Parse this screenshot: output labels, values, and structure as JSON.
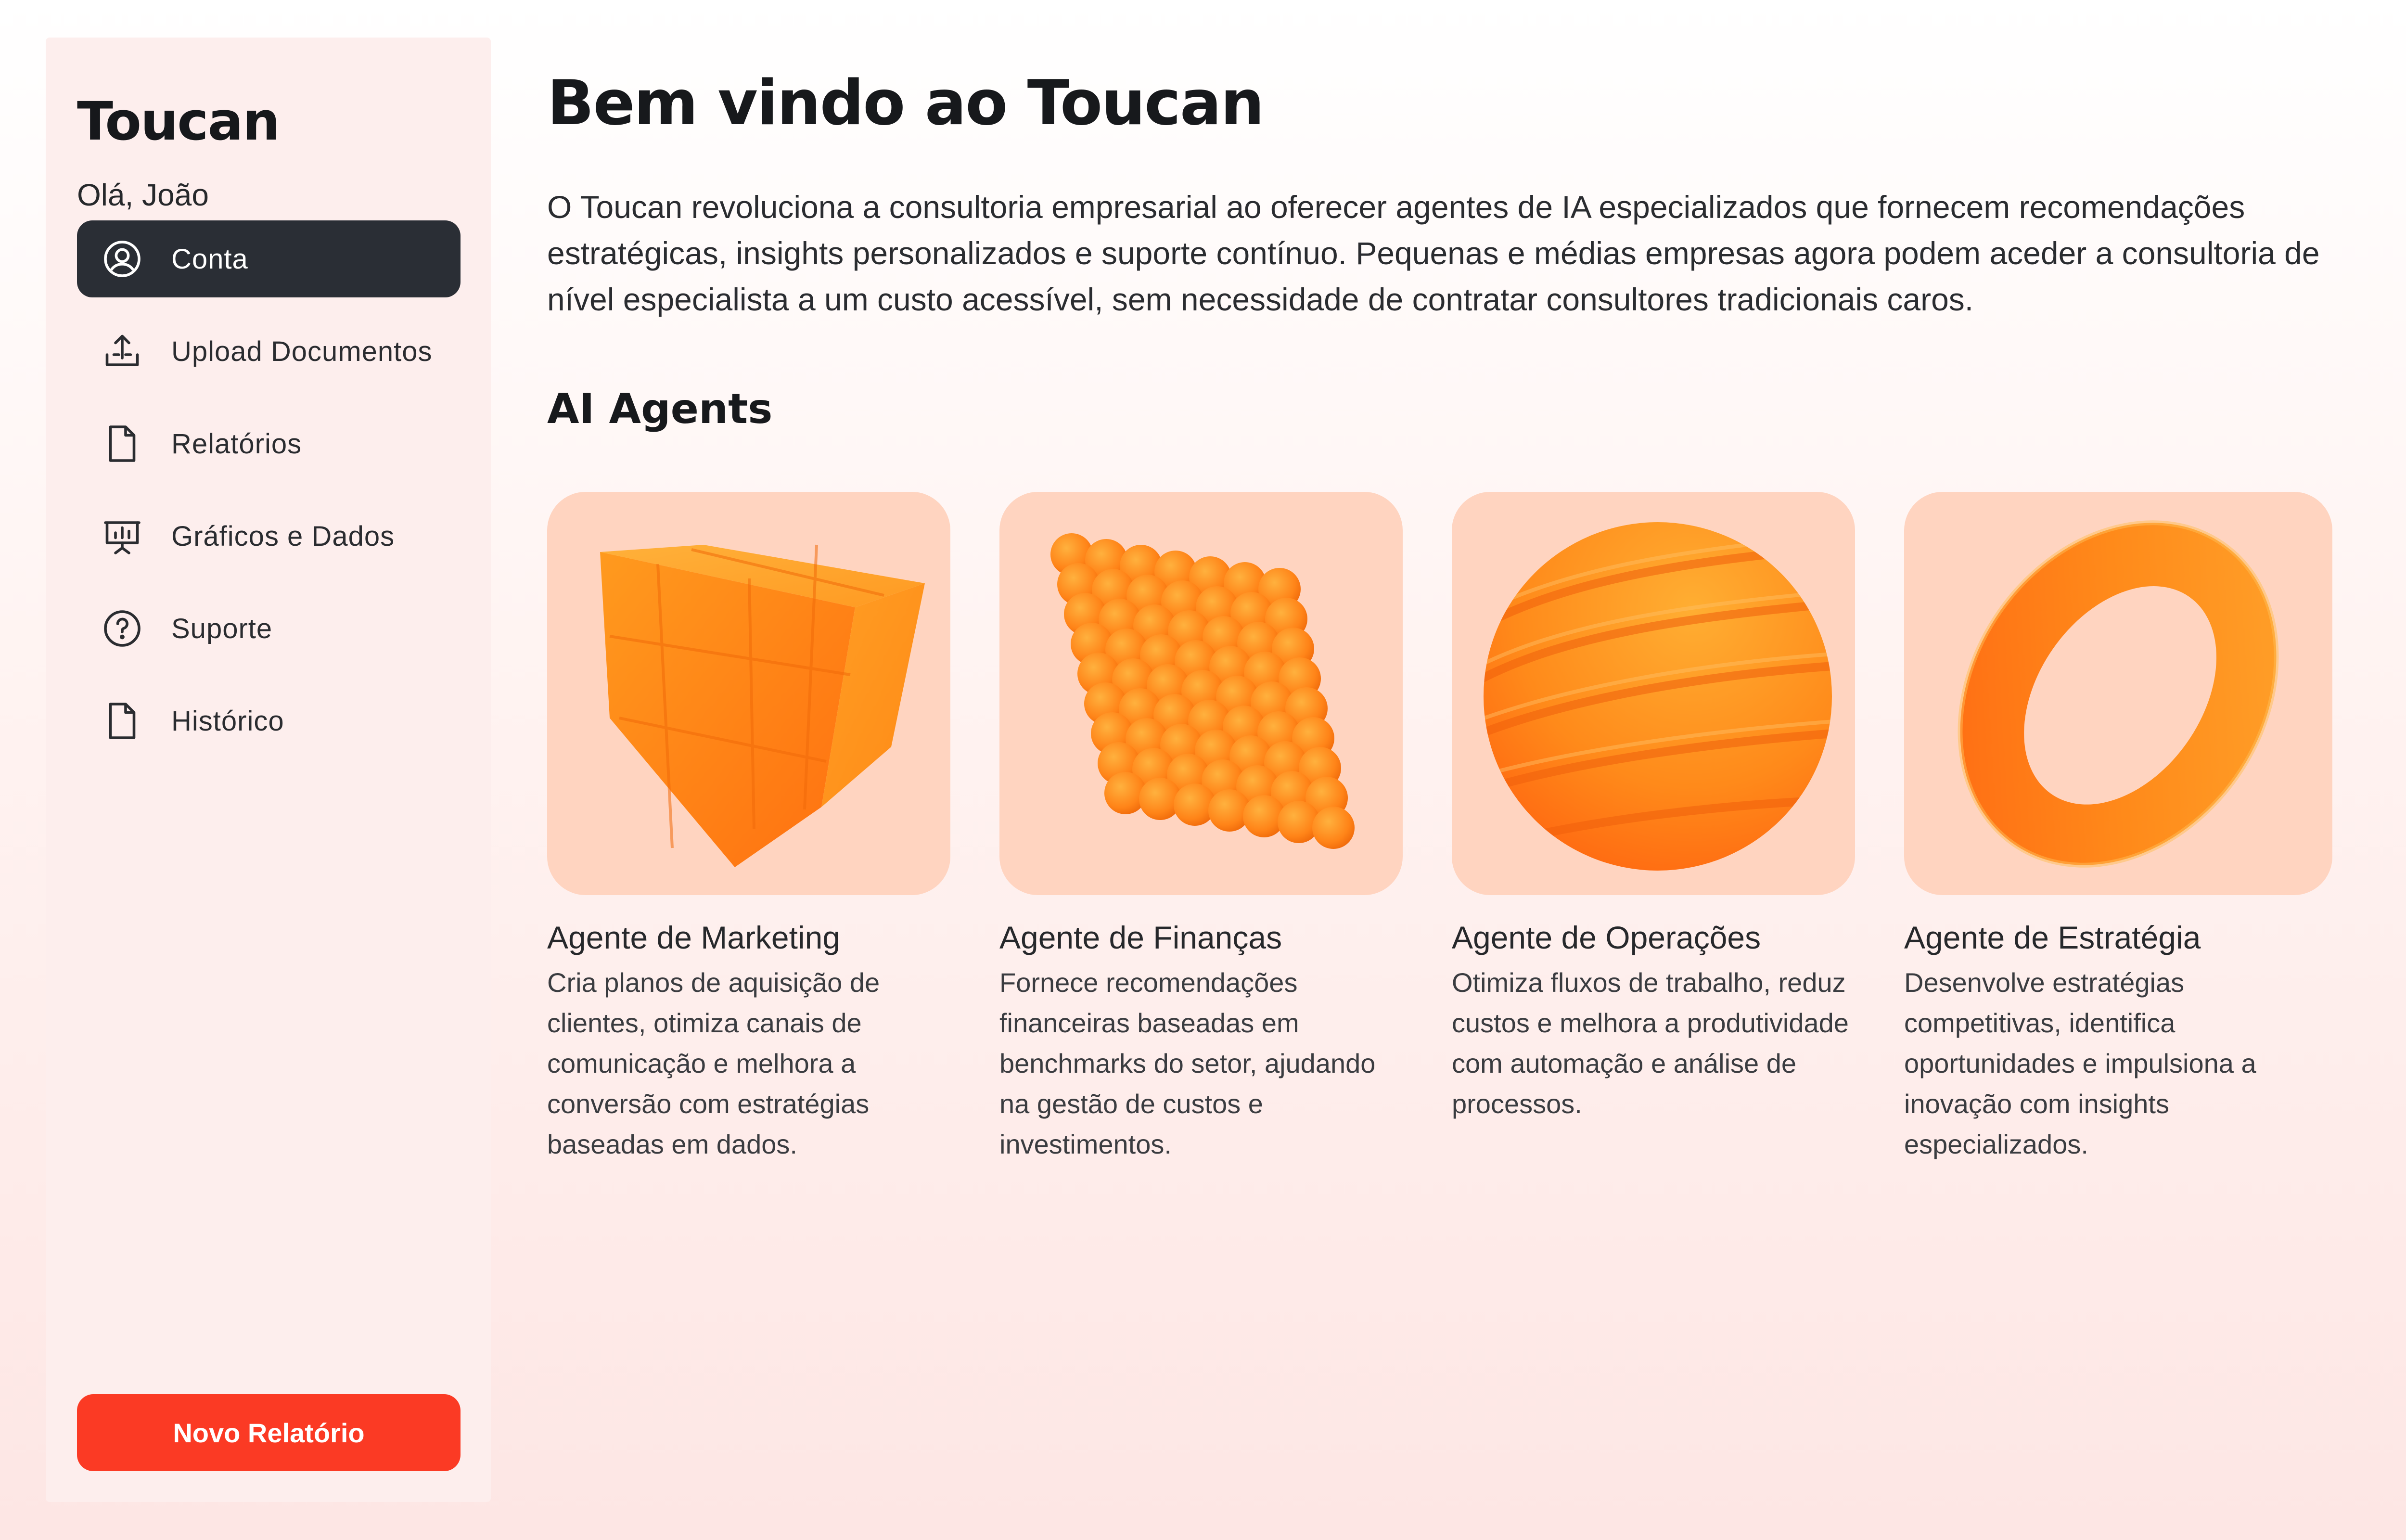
{
  "sidebar": {
    "brand": "Toucan",
    "greeting": "Olá, João",
    "items": [
      {
        "label": "Conta",
        "icon": "user-circle-icon",
        "active": true
      },
      {
        "label": "Upload Documentos",
        "icon": "upload-icon",
        "active": false
      },
      {
        "label": "Relatórios",
        "icon": "document-icon",
        "active": false
      },
      {
        "label": "Gráficos e Dados",
        "icon": "presentation-chart-icon",
        "active": false
      },
      {
        "label": "Suporte",
        "icon": "help-circle-icon",
        "active": false
      },
      {
        "label": "Histórico",
        "icon": "document-icon",
        "active": false
      }
    ],
    "new_report_label": "Novo Relatório"
  },
  "main": {
    "title": "Bem vindo ao Toucan",
    "intro": "O Toucan revoluciona a consultoria empresarial ao oferecer agentes de IA especializados que fornecem recomendações estratégicas, insights personalizados e suporte contínuo. Pequenas e médias empresas agora podem aceder a consultoria de nível especialista a um custo acessível, sem necessidade de contratar consultores tradicionais caros.",
    "agents_heading": "AI Agents",
    "agents": [
      {
        "title": "Agente de Marketing",
        "description": "Cria planos de aquisição de clientes, otimiza canais de comunicação e melhora a conversão com estratégias baseadas em dados.",
        "image": "orange-cube-illustration"
      },
      {
        "title": "Agente de Finanças",
        "description": "Fornece recomendações financeiras baseadas em benchmarks do setor, ajudando na gestão de custos e investimentos.",
        "image": "orange-spheres-cluster-illustration"
      },
      {
        "title": "Agente de Operações",
        "description": "Otimiza fluxos de trabalho, reduz custos e melhora a produtividade com automação e análise de processos.",
        "image": "orange-twisted-sphere-illustration"
      },
      {
        "title": "Agente de Estratégia",
        "description": "Desenvolve estratégias competitivas, identifica oportunidades e impulsiona a inovação com insights especializados.",
        "image": "orange-torus-illustration"
      }
    ]
  },
  "colors": {
    "accent": "#fb3a24",
    "nav_active_bg": "#2a2e35",
    "card_bg": "#ffd4c0",
    "illustration_orange": "#ff7a1a"
  }
}
